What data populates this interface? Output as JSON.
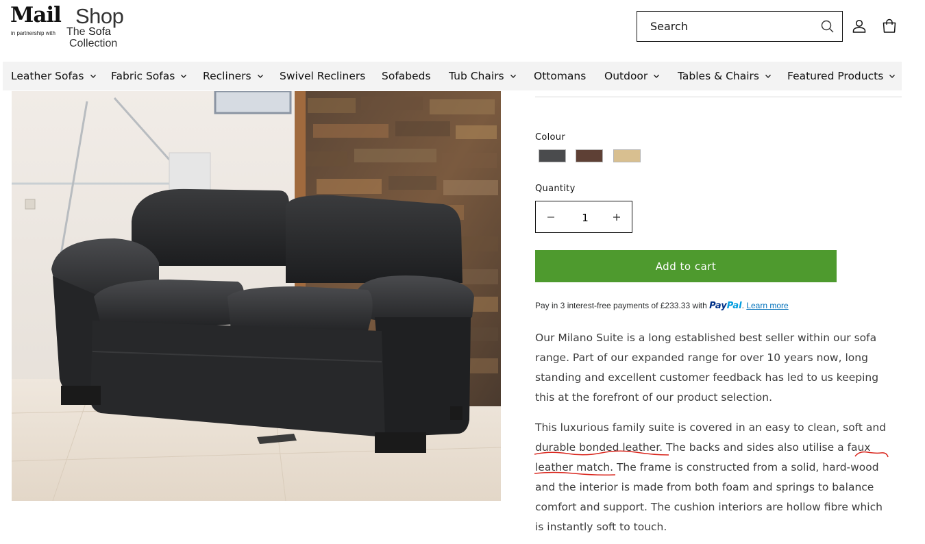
{
  "header": {
    "logo": {
      "brand_mail": "Mail",
      "brand_shop": "Shop",
      "partnership": "in partnership with",
      "partner_line1_a": "The",
      "partner_line1_b": "Sofa",
      "partner_line2": "Collection"
    },
    "search": {
      "placeholder": "Search",
      "icon": "search-icon"
    },
    "account_icon": "user-icon",
    "cart_icon": "cart-icon"
  },
  "nav": {
    "items": [
      {
        "label": "Leather Sofas",
        "dropdown": true
      },
      {
        "label": "Fabric Sofas",
        "dropdown": true
      },
      {
        "label": "Recliners",
        "dropdown": true
      },
      {
        "label": "Swivel Recliners",
        "dropdown": false
      },
      {
        "label": "Sofabeds",
        "dropdown": false
      },
      {
        "label": "Tub Chairs",
        "dropdown": true
      },
      {
        "label": "Ottomans",
        "dropdown": false
      },
      {
        "label": "Outdoor",
        "dropdown": true
      },
      {
        "label": "Tables & Chairs",
        "dropdown": true
      },
      {
        "label": "Featured Products",
        "dropdown": true
      }
    ]
  },
  "product": {
    "colour_label": "Colour",
    "colours": [
      {
        "name": "Charcoal",
        "hex": "#4a4b4d"
      },
      {
        "name": "Brown",
        "hex": "#5e4035"
      },
      {
        "name": "Beige",
        "hex": "#d8bf90"
      }
    ],
    "quantity_label": "Quantity",
    "quantity_value": "1",
    "add_to_cart": "Add to cart",
    "paypal": {
      "text": "Pay in 3 interest-free payments of £233.33 with",
      "logo_a": "Pay",
      "logo_b": "Pal",
      "learn_more": "Learn more"
    },
    "description": {
      "para1_lines": [
        "Our Milano Suite is a long established best seller within our sofa",
        "range. Part of our expanded range for over 10 years now, long",
        "standing and excellent customer feedback has led to us keeping",
        "this at the forefront of our product selection."
      ],
      "para2_lines": [
        "This luxurious family suite is covered in an easy to clean, soft and",
        "durable bonded leather. The backs and sides also utilise a faux",
        "leather match. The frame is constructed from a solid, hard-wood",
        "and the interior is made from both foam and springs to balance",
        "comfort and support. The cushion interiors are hollow fibre which",
        "is instantly soft to touch."
      ]
    }
  },
  "colors": {
    "accent_button": "#4e9a2e",
    "nav_background": "#f3f3f3",
    "spellcheck_underline": "#d9251c"
  }
}
